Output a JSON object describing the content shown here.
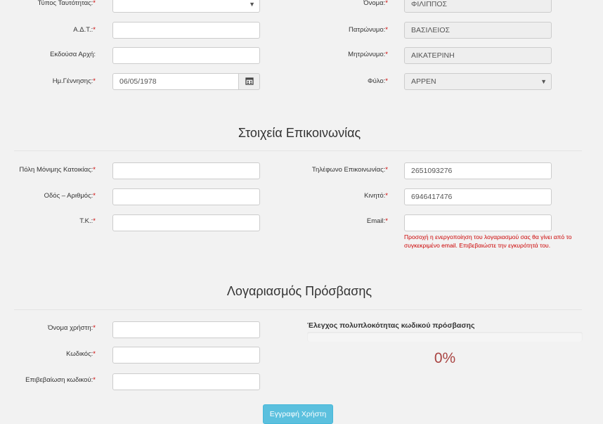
{
  "identity": {
    "left": [
      {
        "label": "Τύπος Ταυτότητας:",
        "value": "",
        "type": "select"
      },
      {
        "label": "Α.Δ.Τ.:",
        "value": "",
        "type": "text"
      },
      {
        "label": "Εκδούσα Αρχή:",
        "value": "",
        "type": "text"
      },
      {
        "label": "Ημ.Γέννησης:",
        "value": "06/05/1978",
        "type": "date"
      }
    ],
    "right": [
      {
        "label": "Όνομα:",
        "value": "ΦΙΛΙΠΠΟΣ",
        "type": "disabled"
      },
      {
        "label": "Πατρώνυμο:",
        "value": "ΒΑΣΙΛΕΙΟΣ",
        "type": "disabled"
      },
      {
        "label": "Μητρώνυμο:",
        "value": "ΑΙΚΑΤΕΡΙΝΗ",
        "type": "disabled"
      },
      {
        "label": "Φύλο:",
        "value": "ΑΡΡΕΝ",
        "type": "select-disabled"
      }
    ]
  },
  "contact": {
    "title": "Στοιχεία Επικοινωνίας",
    "left": [
      {
        "label": "Πόλη Μόνιμης Κατοικίας:",
        "value": ""
      },
      {
        "label": "Οδός – Αριθμός:",
        "value": ""
      },
      {
        "label": "Τ.Κ.:",
        "value": ""
      }
    ],
    "right": [
      {
        "label": "Τηλέφωνο Επικοινωνίας:",
        "value": "2651093276"
      },
      {
        "label": "Κινητό:",
        "value": "6946417476"
      },
      {
        "label": "Email:",
        "value": ""
      }
    ],
    "email_help": "Προσοχή η ενεργοποίηση του λογαριασμού σας θα γίνει από το συγκεκριμένο email. Επιβεβαιώστε την εγκυρότητά του."
  },
  "account": {
    "title": "Λογαριασμός Πρόσβασης",
    "fields": [
      {
        "label": "Όνομα χρήστη:",
        "value": ""
      },
      {
        "label": "Κωδικός:",
        "value": ""
      },
      {
        "label": "Επιβεβαίωση κωδικού:",
        "value": ""
      }
    ],
    "strength_title": "Έλεγχος πολυπλοκότητας κωδικού πρόσβασης",
    "strength_value": 0,
    "strength_text": "0%"
  },
  "required_mark": "*",
  "icons": {
    "calendar": "calendar-icon",
    "select": "chevron-down-icon"
  },
  "colors": {
    "required": "#cc0000",
    "submit": "#5bc0de",
    "percent": "#a94442"
  },
  "submit_label": "Εγγραφή Χρήστη"
}
